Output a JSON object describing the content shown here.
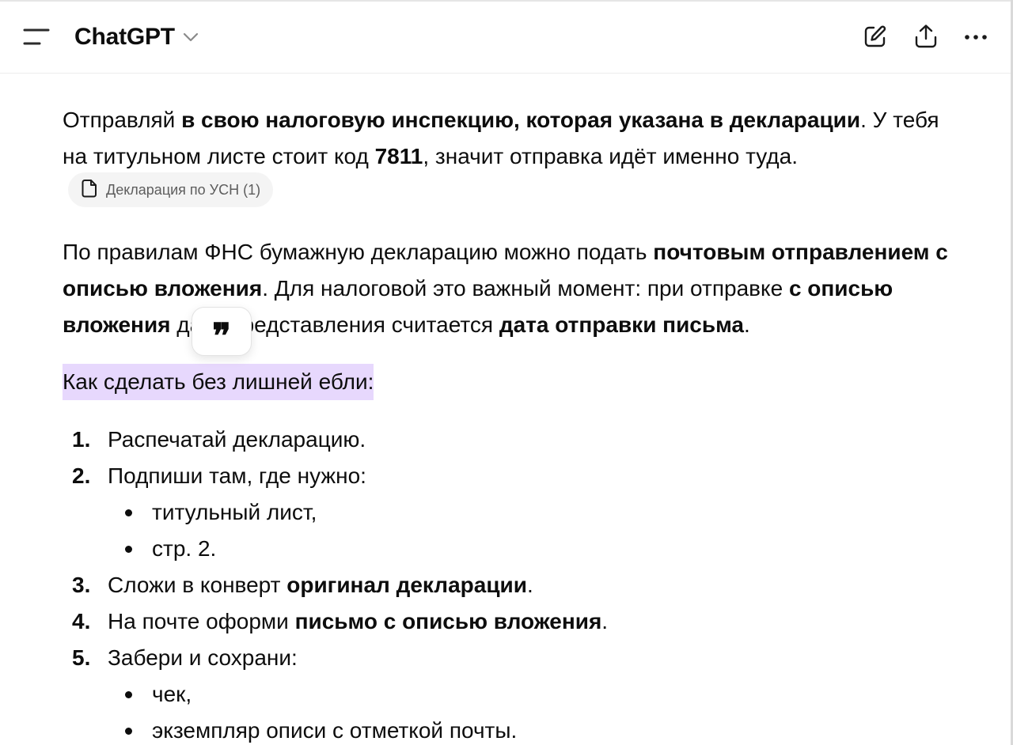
{
  "header": {
    "title": "ChatGPT",
    "menu_icon": "sidebar-menu-icon",
    "dropdown_icon": "chevron-down-icon",
    "new_chat_icon": "compose-icon",
    "share_icon": "share-icon",
    "more_icon": "more-horizontal-icon"
  },
  "message": {
    "p1": {
      "a": "Отправляй ",
      "b": "в свою налоговую инспекцию, которая указана в декларации",
      "c": ". У тебя на титульном листе стоит код ",
      "d": "7811",
      "e": ", значит отправка идёт именно туда."
    },
    "source_chip": {
      "label": "Декларация по УСН (1)",
      "icon": "document-icon"
    },
    "p2": {
      "a": "По правилам ФНС бумажную декларацию можно подать ",
      "b": "почтовым отправлением с описью вложения",
      "c": ". Для налоговой это важный момент: при отправке ",
      "d": "с описью вложения",
      "e": " дата представления считается ",
      "f": "дата отправки письма",
      "g": "."
    },
    "highlight_text": "Как сделать без лишней ебли:",
    "quote_button": {
      "glyph": "❞",
      "icon": "quote-icon"
    },
    "steps": [
      {
        "num": "1.",
        "text": "Распечатай декларацию."
      },
      {
        "num": "2.",
        "text": "Подпиши там, где нужно:",
        "sub": [
          "титульный лист,",
          "стр. 2."
        ]
      },
      {
        "num": "3.",
        "a": "Сложи в конверт ",
        "b": "оригинал декларации",
        "c": "."
      },
      {
        "num": "4.",
        "a": "На почте оформи ",
        "b": "письмо с описью вложения",
        "c": "."
      },
      {
        "num": "5.",
        "text": "Забери и сохрани:",
        "sub": [
          "чек,",
          "экземпляр описи с отметкой почты."
        ]
      }
    ]
  },
  "colors": {
    "highlight": "#e7d8fd",
    "text": "#0d0d0d",
    "chip_bg": "#f4f4f4",
    "chip_text": "#5d5d5d"
  }
}
